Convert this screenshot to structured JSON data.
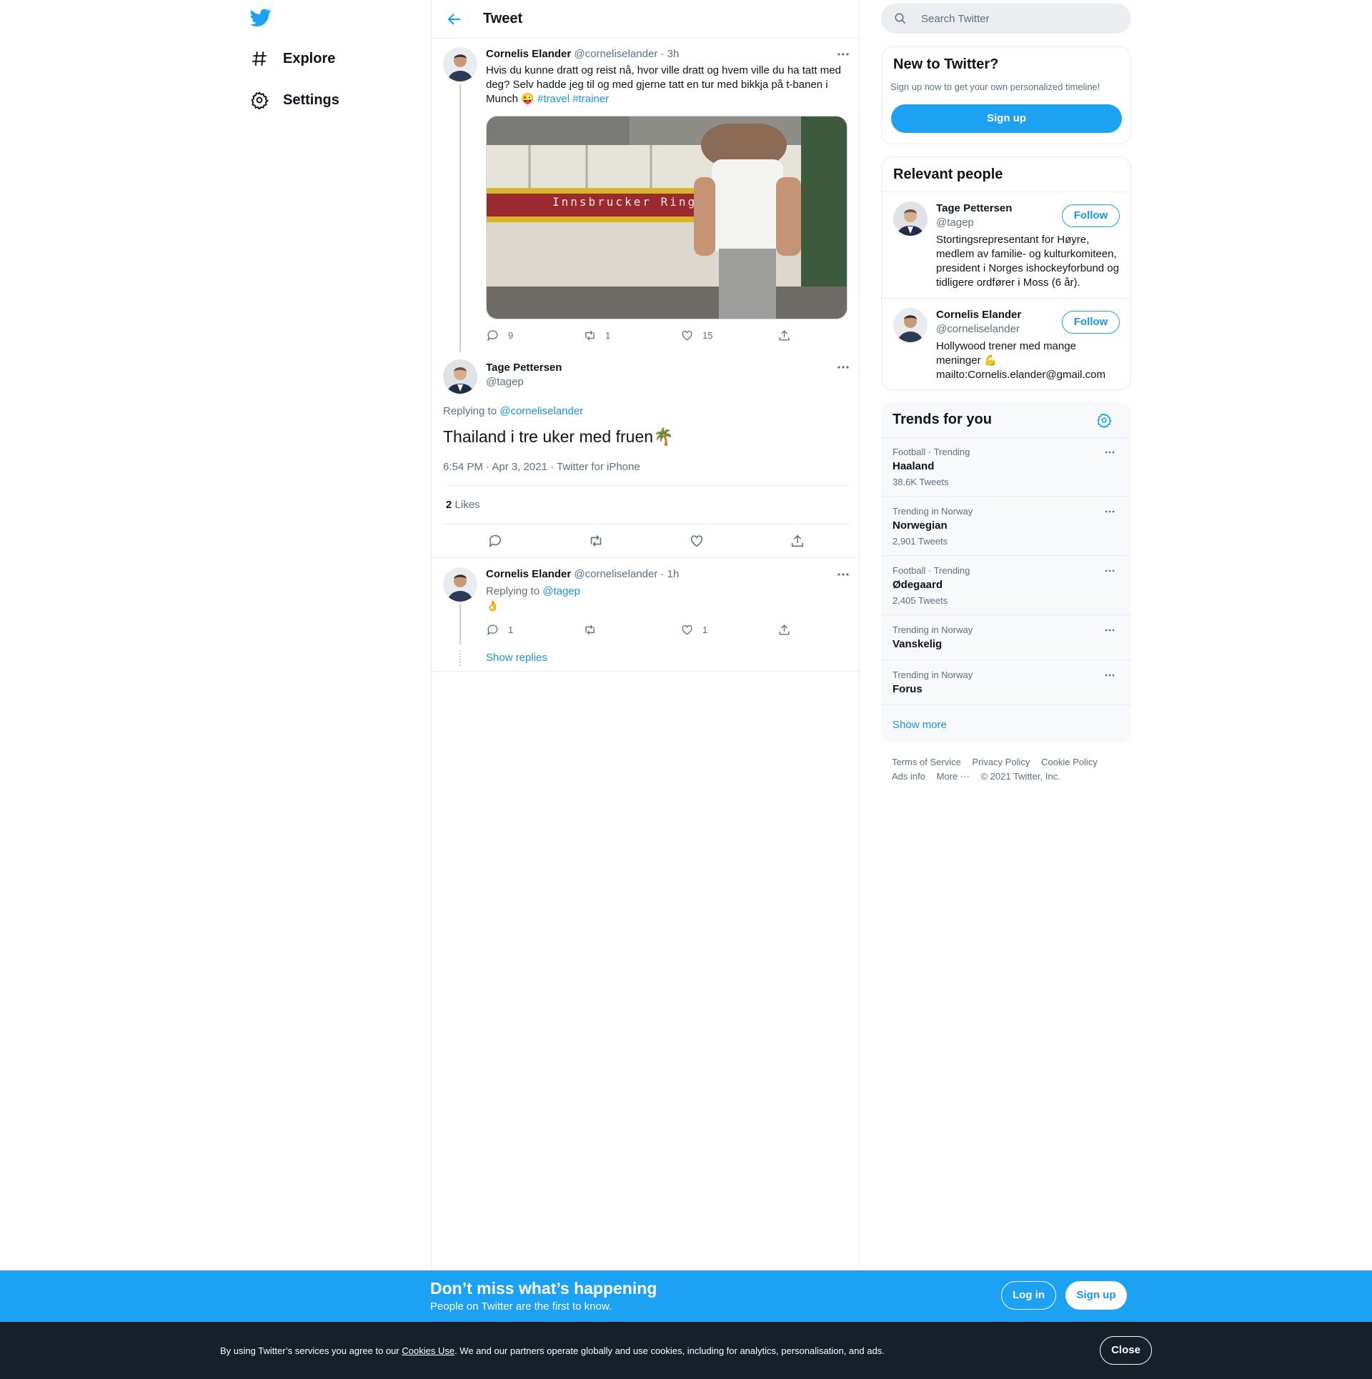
{
  "nav": {
    "logo": "twitter-bird-icon",
    "items": [
      {
        "label": "Explore",
        "icon": "hashtag-icon"
      },
      {
        "label": "Settings",
        "icon": "gear-icon"
      }
    ]
  },
  "header": {
    "title": "Tweet"
  },
  "thread": {
    "first": {
      "name": "Cornelis Elander",
      "handle": "@corneliselander",
      "time": "· 3h",
      "text": "Hvis du kunne dratt og reist nå, hvor ville dratt og hvem ville du ha tatt med deg? Selv hadde jeg til og med gjerne tatt en tur med bikkja på t-banen i Munch 😜",
      "hashtags": [
        "#travel",
        "#trainer"
      ],
      "media_sign": "Innsbrucker Ring",
      "replies": "9",
      "retweets": "1",
      "likes": "15"
    },
    "focused": {
      "name": "Tage Pettersen",
      "handle": "@tagep",
      "replying_label": "Replying to",
      "replying_to": "@corneliselander",
      "text": "Thailand i tre uker med fruen🌴",
      "meta": "6:54 PM · Apr 3, 2021 · Twitter for iPhone",
      "likes_count": "2",
      "likes_label": "Likes"
    },
    "reply": {
      "name": "Cornelis Elander",
      "handle": "@corneliselander",
      "time": "· 1h",
      "replying_label": "Replying to",
      "replying_to": "@tagep",
      "text": "👌",
      "replies": "1",
      "retweets": "",
      "likes": "1",
      "show_replies": "Show replies"
    }
  },
  "sidebar": {
    "search_placeholder": "Search Twitter",
    "new_to_twitter": {
      "title": "New to Twitter?",
      "subtitle": "Sign up now to get your own personalized timeline!",
      "button": "Sign up"
    },
    "relevant_people": {
      "title": "Relevant people",
      "people": [
        {
          "name": "Tage Pettersen",
          "handle": "@tagep",
          "follow": "Follow",
          "bio": "Stortingsrepresentant for Høyre, medlem av familie- og kulturkomiteen, president i Norges ishockeyforbund og tidligere ordfører i Moss (6 år)."
        },
        {
          "name": "Cornelis Elander",
          "handle": "@corneliselander",
          "follow": "Follow",
          "bio_line1": "Hollywood trener med mange meninger 💪",
          "bio_line2": "mailto:Cornelis.elander@gmail.com"
        }
      ]
    },
    "trends": {
      "title": "Trends for you",
      "items": [
        {
          "meta": "Football · Trending",
          "name": "Haaland",
          "count": "38.6K Tweets"
        },
        {
          "meta": "Trending in Norway",
          "name": "Norwegian",
          "count": "2,901 Tweets"
        },
        {
          "meta": "Football · Trending",
          "name": "Ødegaard",
          "count": "2,405 Tweets"
        },
        {
          "meta": "Trending in Norway",
          "name": "Vanskelig",
          "count": ""
        },
        {
          "meta": "Trending in Norway",
          "name": "Forus",
          "count": ""
        }
      ],
      "show_more": "Show more"
    },
    "footer": {
      "terms": "Terms of Service",
      "privacy": "Privacy Policy",
      "cookie": "Cookie Policy",
      "ads": "Ads info",
      "more": "More ···",
      "copyright": "© 2021 Twitter, Inc."
    }
  },
  "promo": {
    "title": "Don’t miss what’s happening",
    "subtitle": "People on Twitter are the first to know.",
    "login": "Log in",
    "signup": "Sign up"
  },
  "cookie": {
    "text_before": "By using Twitter’s services you agree to our ",
    "link": "Cookies Use",
    "text_after": ". We and our partners operate globally and use cookies, including for analytics, personalisation, and ads.",
    "close": "Close"
  },
  "colors": {
    "accent": "#1da1f2",
    "link": "#1b95e0",
    "muted": "#5b7083",
    "dark": "#15202b"
  }
}
